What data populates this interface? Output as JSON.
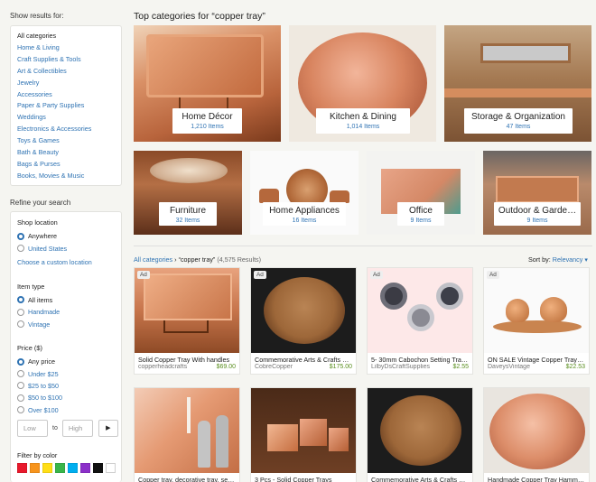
{
  "sidebar": {
    "show_results_heading": "Show results for:",
    "categories": [
      "All categories",
      "Home & Living",
      "Craft Supplies & Tools",
      "Art & Collectibles",
      "Jewelry",
      "Accessories",
      "Paper & Party Supplies",
      "Weddings",
      "Electronics & Accessories",
      "Toys & Games",
      "Bath & Beauty",
      "Bags & Purses",
      "Books, Movies & Music"
    ],
    "refine_heading": "Refine your search",
    "shop_location": {
      "title": "Shop location",
      "options": [
        "Anywhere",
        "United States"
      ],
      "selected": 0,
      "custom_link": "Choose a custom location"
    },
    "item_type": {
      "title": "Item type",
      "options": [
        "All items",
        "Handmade",
        "Vintage"
      ],
      "selected": 0
    },
    "price": {
      "title": "Price ($)",
      "options": [
        "Any price",
        "Under $25",
        "$25 to $50",
        "$50 to $100",
        "Over $100"
      ],
      "selected": 0,
      "low_placeholder": "Low",
      "to_label": "to",
      "high_placeholder": "High",
      "go_icon": "▶"
    },
    "color_filter": {
      "title": "Filter by color",
      "colors": [
        "#e8192c",
        "#f7941d",
        "#ffde17",
        "#39b54a",
        "#00aeef",
        "#8b2fc9",
        "#111111",
        "#ffffff"
      ]
    }
  },
  "main": {
    "title": "Top categories for “copper tray”",
    "top_categories": [
      {
        "name": "Home Décor",
        "count": "1,210 Items"
      },
      {
        "name": "Kitchen & Dining",
        "count": "1,014 Items"
      },
      {
        "name": "Storage & Organization",
        "count": "47 Items"
      },
      {
        "name": "Furniture",
        "count": "32 Items"
      },
      {
        "name": "Home Appliances",
        "count": "16 Items"
      },
      {
        "name": "Office",
        "count": "9 Items"
      },
      {
        "name": "Outdoor & Garde…",
        "count": "9 Items"
      }
    ],
    "breadcrumb": {
      "root": "All categories",
      "separator": "›",
      "query": "“copper tray”",
      "results": "(4,575 Results)"
    },
    "sort": {
      "label": "Sort by:",
      "value": "Relevancy"
    },
    "ad_label": "Ad",
    "listings": [
      {
        "title": "Solid Copper Tray With handles",
        "shop": "copperheadcrafts",
        "price": "$69.00",
        "ad": true
      },
      {
        "title": "Commemorative Arts & Crafts Co…",
        "shop": "CobreCopper",
        "price": "$175.00",
        "ad": true
      },
      {
        "title": "5- 30mm Cabochon Setting Trays …",
        "shop": "LilbyDsCraftSupplies",
        "price": "$2.55",
        "ad": true
      },
      {
        "title": "ON SALE Vintage Copper Tray Sug…",
        "shop": "DaveysVintage",
        "price": "$22.53",
        "ad": true
      },
      {
        "title": "Copper tray, decorative tray, servi…",
        "shop": "",
        "price": "",
        "ad": false
      },
      {
        "title": "3 Pcs - Solid Copper Trays",
        "shop": "",
        "price": "",
        "ad": false
      },
      {
        "title": "Commemorative Arts & Crafts Co…",
        "shop": "",
        "price": "",
        "ad": false
      },
      {
        "title": "Handmade Copper Tray Hammere…",
        "shop": "",
        "price": "",
        "ad": false
      }
    ]
  }
}
